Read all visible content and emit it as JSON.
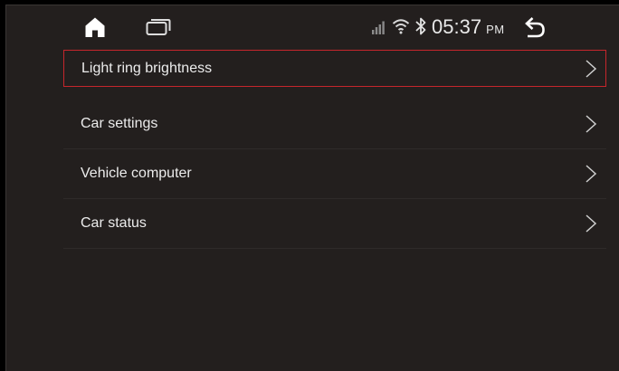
{
  "status_bar": {
    "time": "05:37",
    "ampm": "PM",
    "icons": [
      "home-icon",
      "recent-apps-icon",
      "signal-icon",
      "wifi-icon",
      "bluetooth-icon",
      "back-icon"
    ]
  },
  "menu": {
    "items": [
      {
        "label": "Light ring brightness",
        "selected": true,
        "icon": "chevron-right-icon"
      },
      {
        "label": "Car settings",
        "selected": false,
        "icon": "chevron-right-icon"
      },
      {
        "label": "Vehicle computer",
        "selected": false,
        "icon": "chevron-right-icon"
      },
      {
        "label": "Car status",
        "selected": false,
        "icon": "chevron-right-icon"
      }
    ]
  },
  "colors": {
    "background": "#231f1e",
    "text": "#ececec",
    "selection_border": "#c6262c"
  }
}
